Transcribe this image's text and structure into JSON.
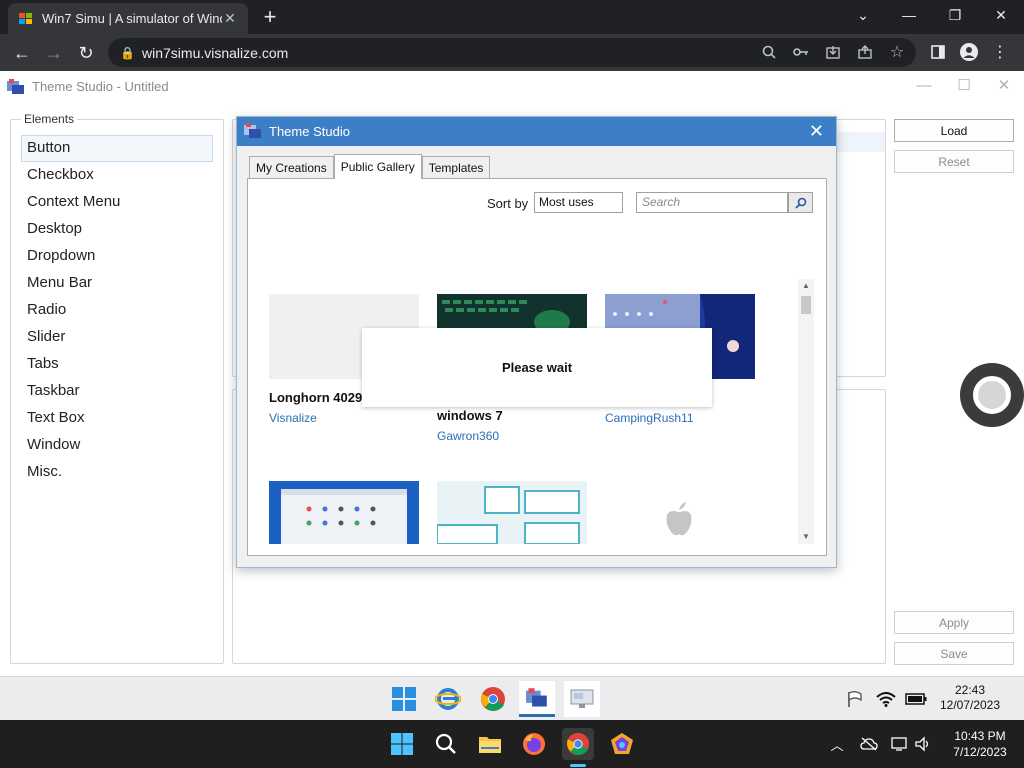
{
  "browser": {
    "tab_title": "Win7 Simu | A simulator of Windows 7",
    "url": "win7simu.visnalize.com"
  },
  "app": {
    "title": "Theme Studio - Untitled",
    "elements_legend": "Elements",
    "elements": [
      "Button",
      "Checkbox",
      "Context Menu",
      "Desktop",
      "Dropdown",
      "Menu Bar",
      "Radio",
      "Slider",
      "Tabs",
      "Taskbar",
      "Text Box",
      "Window",
      "Misc."
    ],
    "selected_element": "Button",
    "buttons": {
      "load": "Load",
      "reset": "Reset",
      "apply": "Apply",
      "save": "Save"
    }
  },
  "dialog": {
    "title": "Theme Studio",
    "tabs": [
      "My Creations",
      "Public Gallery",
      "Templates"
    ],
    "active_tab": "Public Gallery",
    "sort_label": "Sort by",
    "sort_value": "Most uses",
    "search_placeholder": "Search",
    "items": [
      {
        "name": "Longhorn 4029",
        "author": "Visnalize"
      },
      {
        "name": "windows 7",
        "author": "Gawron360"
      },
      {
        "name": "",
        "author": "CampingRush11"
      }
    ],
    "wait_message": "Please wait"
  },
  "sim_taskbar": {
    "time": "22:43",
    "date": "12/07/2023"
  },
  "os_taskbar": {
    "time": "10:43 PM",
    "date": "7/12/2023"
  },
  "colors": {
    "dialog_title_bar": "#3d7fc6",
    "author_link": "#2a6fb5",
    "browser_dark": "#202124"
  }
}
